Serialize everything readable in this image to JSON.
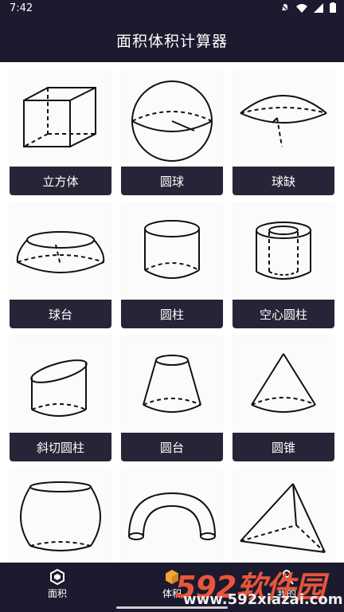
{
  "status": {
    "time": "7:42"
  },
  "app": {
    "title": "面积体积计算器"
  },
  "shapes": [
    {
      "label": "立方体",
      "icon": "cube-icon"
    },
    {
      "label": "圆球",
      "icon": "sphere-icon"
    },
    {
      "label": "球缺",
      "icon": "spherical-cap-icon"
    },
    {
      "label": "球台",
      "icon": "spherical-segment-icon"
    },
    {
      "label": "圆柱",
      "icon": "cylinder-icon"
    },
    {
      "label": "空心圆柱",
      "icon": "hollow-cylinder-icon"
    },
    {
      "label": "斜切圆柱",
      "icon": "truncated-cylinder-icon"
    },
    {
      "label": "圆台",
      "icon": "frustum-icon"
    },
    {
      "label": "圆锥",
      "icon": "cone-icon"
    },
    {
      "label": "",
      "icon": "barrel-icon"
    },
    {
      "label": "",
      "icon": "torus-icon"
    },
    {
      "label": "",
      "icon": "tetrahedron-icon"
    }
  ],
  "nav": {
    "area": "面积",
    "volume": "体积",
    "mine": "我的"
  },
  "watermark": {
    "logo": "592软件园",
    "url": "www.592xiazai.com"
  },
  "colors": {
    "bar": "#1b1a2e",
    "label_bg": "#262537"
  }
}
